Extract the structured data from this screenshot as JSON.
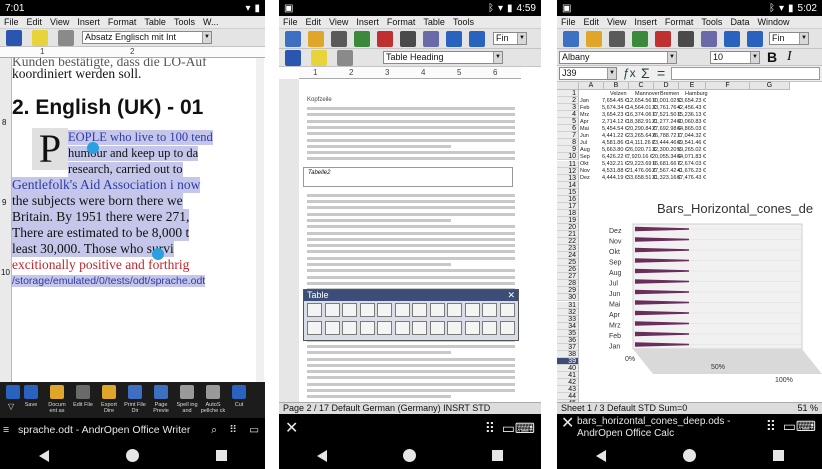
{
  "phone1": {
    "time": "7:01",
    "menu": [
      "File",
      "Edit",
      "View",
      "Insert",
      "Format",
      "Table",
      "Tools",
      "W..."
    ],
    "style_combo": "Absatz Englisch mit Int",
    "ruler_marks": [
      "1",
      "2"
    ],
    "vruler_marks": [
      "8",
      "9",
      "10"
    ],
    "doc_lines": [
      "Kunden bestätigte, dass die LO-Auf",
      "koordiniert werden soll.",
      "2. English (UK) - 01",
      "EOPLE who live to 100 tend",
      "humour and keep up to da",
      "research, carried out to",
      "Gentlefolk's Aid Association i now",
      "the subjects were born there we",
      "Britain. By 1951 there were 271,",
      "There are estimated to be 8,000 t",
      "least 30,000. Those who survi",
      "excitionally positive and forthrig",
      "/storage/emulated/0/tests/odt/sprache.odt"
    ],
    "dropcap": "P",
    "bottom_labels": [
      "Save",
      "Docum ent as",
      "Edit File",
      "Export Dire",
      "Print File Dir",
      "Page Previe",
      "Spell ing and",
      "AutoS pellche ck",
      "Cut"
    ],
    "app_title": "sprache.odt - AndrOpen Office Writer"
  },
  "phone2": {
    "time": "4:59",
    "menu": [
      "File",
      "Edit",
      "View",
      "Insert",
      "Format",
      "Table",
      "Tools"
    ],
    "find_box": "Fin",
    "style_combo": "Table Heading",
    "ruler_marks": [
      "1",
      "2",
      "3",
      "4",
      "5",
      "6"
    ],
    "body_heading": "Kopfzeile",
    "table_label": "Tabelle2",
    "table_panel_title": "Table",
    "status": "Page 2 / 17  Default  German (Germany)  INSRT  STD"
  },
  "phone3": {
    "time": "5:02",
    "menu": [
      "File",
      "Edit",
      "View",
      "Insert",
      "Format",
      "Tools",
      "Data",
      "Window"
    ],
    "find_box": "Fin",
    "font_combo": "Albany",
    "size_combo": "10",
    "bold": "B",
    "italic": "I",
    "cell_ref": "J39",
    "sigma": "Σ",
    "equals": "=",
    "cols": [
      "A",
      "B",
      "C",
      "D",
      "E",
      "F",
      "G"
    ],
    "header_row": [
      "",
      "Velzen",
      "Mannover",
      "Bremen",
      "Hamburg"
    ],
    "months_short": [
      "Jan",
      "Feb",
      "Mrz",
      "Apr",
      "Mai",
      "Jun",
      "Jul",
      "Aug",
      "Sep",
      "Okt",
      "Nov",
      "Dez"
    ],
    "rows_data": [
      [
        "7,654.45 €",
        "12,654.56 €",
        "10,001.02 €",
        "53,654.23 €"
      ],
      [
        "5,674.34 €",
        "14,564.01 €",
        "33,761.76 €",
        "42,456.43 €"
      ],
      [
        "3,654.23 €",
        "16,374.06 €",
        "17,521.50 €",
        "15,236.13 €"
      ],
      [
        "2,714.12 €",
        "18,382.91 €",
        "21,277.24 €",
        "60,060.83 €"
      ],
      [
        "5,454.54 €",
        "20,290.84 €",
        "27,692.98 €",
        "64,865.03 €"
      ],
      [
        "4,441.22 €",
        "23,265.64 €",
        "26,788.72 €",
        "17,044.32 €"
      ],
      [
        "4,581.86 €",
        "14,111.26 €",
        "23,444.46 €",
        "69,541.46 €"
      ],
      [
        "5,663.80 €",
        "26,020.71 €",
        "32,300.20 €",
        "59,265.02 €"
      ],
      [
        "6,426.22 €",
        "7,920.16 €",
        "20,055.34 €",
        "64,071.83 €"
      ],
      [
        "5,432.21 €",
        "29,223.69 €",
        "16,681.66 €",
        "72,674.03 €"
      ],
      [
        "4,531.88 €",
        "21,476.06 €",
        "27,567.42 €",
        "41,676.23 €"
      ],
      [
        "4,444.19 €",
        "33,658.51 €",
        "31,323.16 €",
        "67,476.43 €"
      ]
    ],
    "row_numbers": [
      "1",
      "2",
      "3",
      "4",
      "5",
      "6",
      "7",
      "8",
      "9",
      "10",
      "11",
      "12",
      "13",
      "14",
      "15",
      "16",
      "17",
      "18",
      "19",
      "20",
      "21",
      "22",
      "23",
      "24",
      "25",
      "26",
      "27",
      "28",
      "29",
      "30",
      "31",
      "32",
      "33",
      "34",
      "35",
      "36",
      "37",
      "38",
      "39",
      "40",
      "41",
      "42",
      "43",
      "44",
      "45"
    ],
    "chart_title": "Bars_Horizontal_cones_de",
    "chart_months": [
      "Dez",
      "Nov",
      "Okt",
      "Sep",
      "Aug",
      "Jul",
      "Jun",
      "Mai",
      "Apr",
      "Mrz",
      "Feb",
      "Jan"
    ],
    "chart_x_ticks": [
      "0%",
      "50%",
      "100%"
    ],
    "status": "Sheet 1 / 3   Default        STD        Sum=0",
    "zoom": "51 %",
    "app_title": "bars_horizontal_cones_deep.ods - AndrOpen Office Calc"
  },
  "chart_data": {
    "type": "bar",
    "title": "Bars_Horizontal_cones_de",
    "categories": [
      "Jan",
      "Feb",
      "Mrz",
      "Apr",
      "Mai",
      "Jun",
      "Jul",
      "Aug",
      "Sep",
      "Okt",
      "Nov",
      "Dez"
    ],
    "x_ticks": [
      "0%",
      "50%",
      "100%"
    ],
    "orientation": "horizontal"
  }
}
